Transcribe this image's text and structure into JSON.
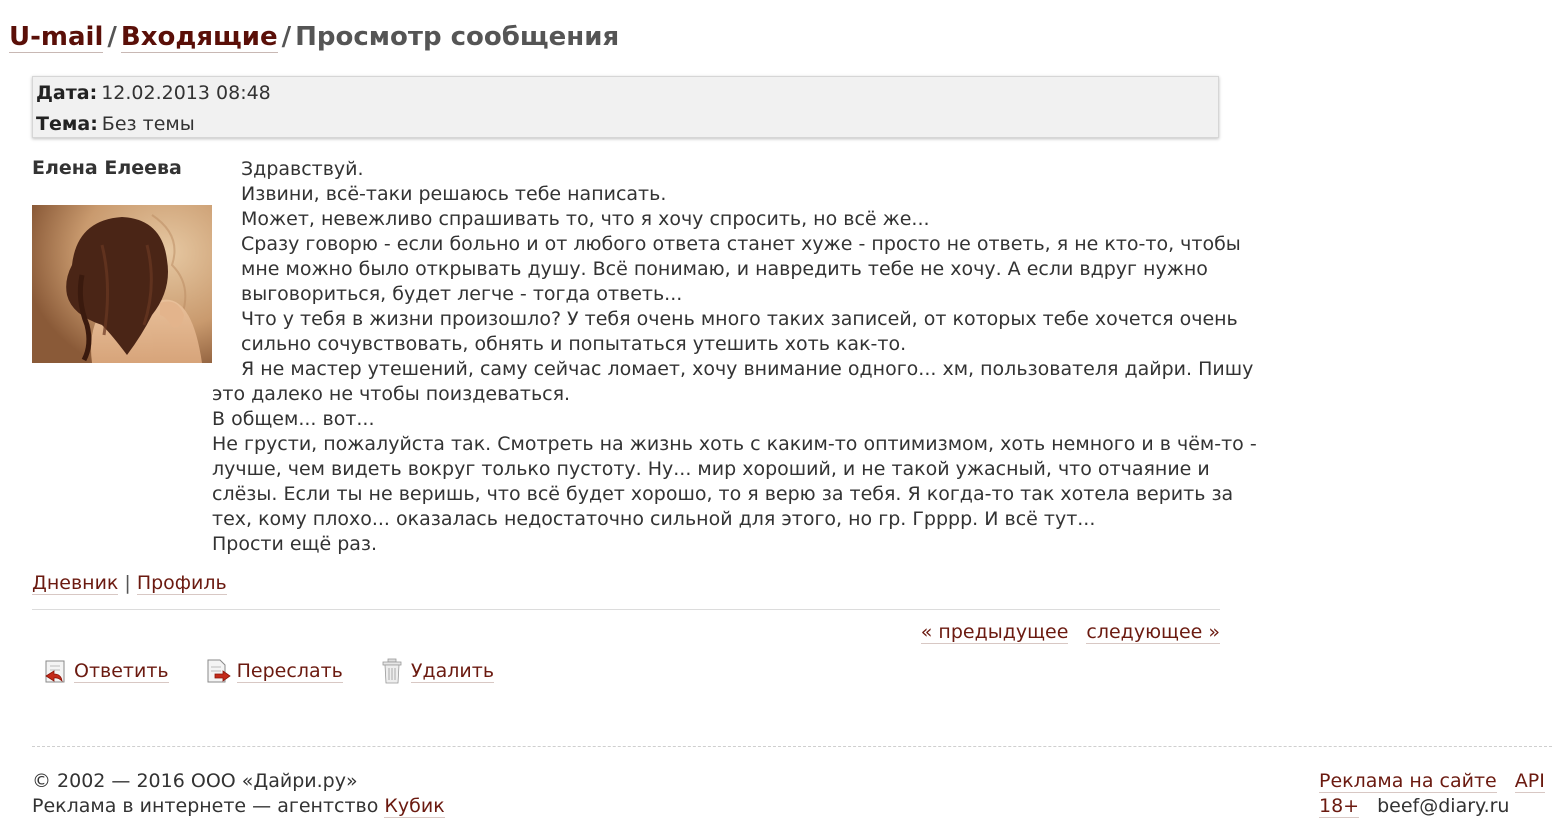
{
  "breadcrumb": {
    "root": "U-mail",
    "folder": "Входящие",
    "current": "Просмотр сообщения",
    "separator": "/"
  },
  "meta": {
    "date_label": "Дата:",
    "date_value": "12.02.2013 08:48",
    "subject_label": "Тема:",
    "subject_value": "Без темы"
  },
  "author": {
    "name": "Елена Елеева",
    "diary_link": "Дневник",
    "profile_link": "Профиль",
    "links_separator": "|"
  },
  "message": {
    "lines": [
      "Здравствуй.",
      "Извини, всё-таки решаюсь тебе написать.",
      "Может, невежливо спрашивать то, что я хочу спросить, но всё же...",
      "Сразу говорю - если больно и от любого ответа станет хуже - просто не ответь, я не кто-то, чтобы",
      "мне можно было открывать душу. Всё понимаю, и навредить тебе не хочу. А если вдруг нужно",
      "выговориться, будет легче - тогда ответь...",
      "Что у тебя в жизни произошло? У тебя очень много таких записей, от которых тебе хочется очень",
      "сильно сочувствовать, обнять и попытаться утешить хоть как-то.",
      "Я не мастер утешений, саму сейчас ломает, хочу внимание одного... хм, пользователя дайри. Пишу",
      "это далеко не чтобы поиздеваться.",
      "В общем... вот...",
      "Не грусти, пожалуйста так. Смотреть на жизнь хоть с каким-то оптимизмом, хоть немного и в чём-то -",
      "лучше, чем видеть вокруг только пустоту. Ну... мир хороший, и не такой ужасный, что отчаяние и",
      "слёзы. Если ты не веришь, что всё будет хорошо, то я верю за тебя. Я когда-то так хотела верить за",
      "тех, кому плохо... оказалась недостаточно сильной для этого, но гр. Грррр. И всё тут...",
      "Прости ещё раз."
    ]
  },
  "pager": {
    "prev": "« предыдущее",
    "next": "следующее »"
  },
  "actions": {
    "reply": "Ответить",
    "forward": "Переслать",
    "delete": "Удалить"
  },
  "footer": {
    "copyright": "© 2002 — 2016 ООО «Дайри.ру»",
    "ads_text": "Реклама в интернете — агентство ",
    "ads_agency": "Кубик",
    "ads_on_site": "Реклама на сайте",
    "api": "API",
    "age": "18+",
    "email": "beef@diary.ru"
  },
  "colors": {
    "link": "#6b1a10",
    "breadcrumb_link": "#5a0f08",
    "meta_bg": "#f1f1f1",
    "text": "#333333"
  }
}
